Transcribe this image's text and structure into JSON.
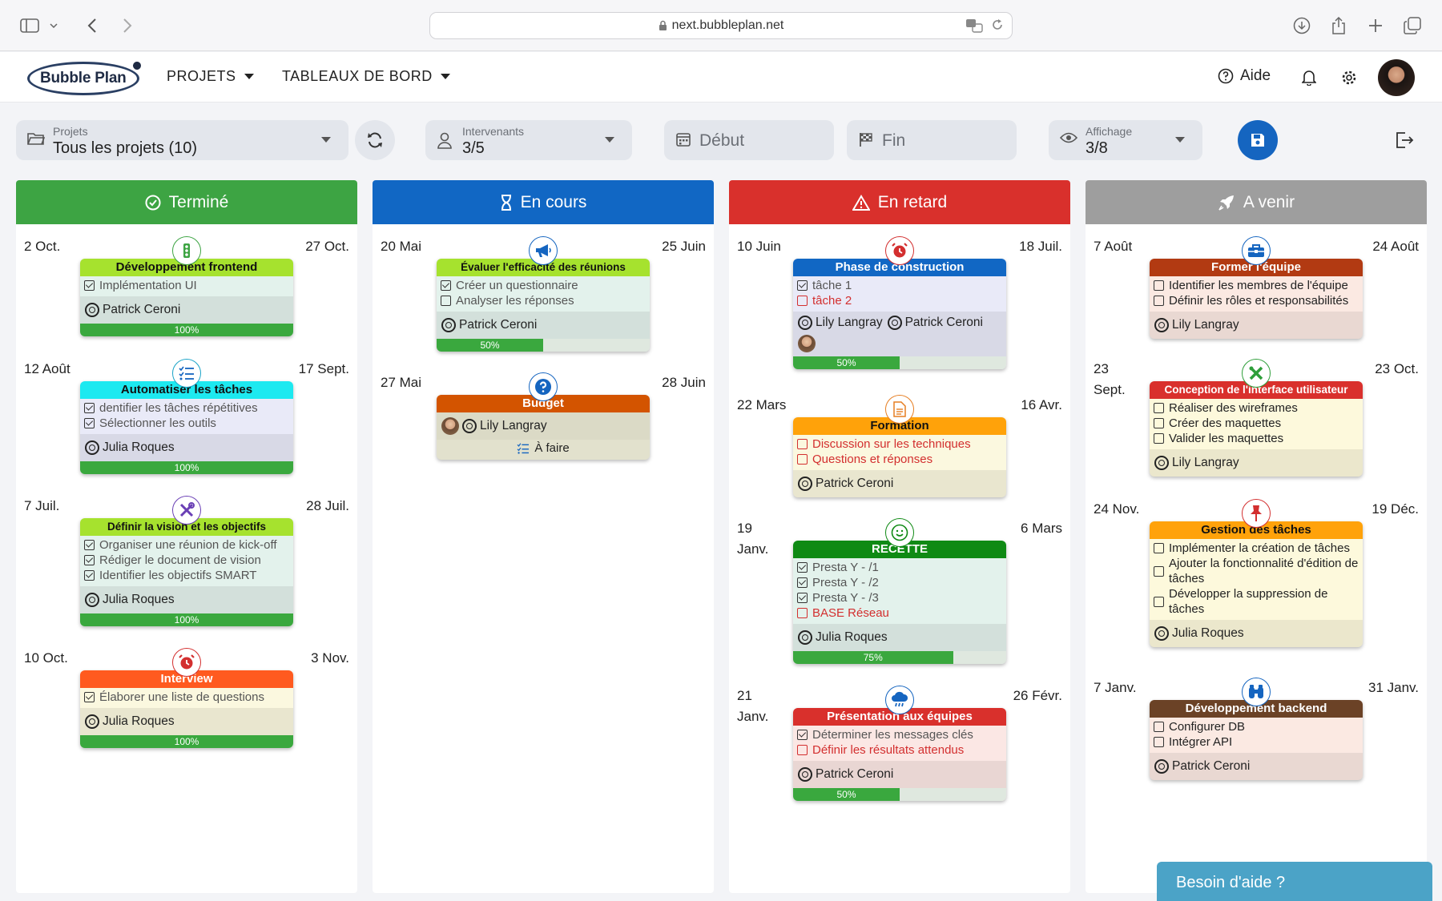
{
  "browser": {
    "url": "next.bubbleplan.net"
  },
  "header": {
    "logo": "Bubble Plan",
    "menus": [
      {
        "label": "PROJETS"
      },
      {
        "label": "TABLEAUX DE BORD"
      }
    ],
    "help_label": "Aide"
  },
  "filters": {
    "projects": {
      "label": "Projets",
      "value": "Tous les projets (10)"
    },
    "people": {
      "label": "Intervenants",
      "value": "3/5"
    },
    "start": {
      "placeholder": "Début"
    },
    "end": {
      "placeholder": "Fin"
    },
    "display": {
      "label": "Affichage",
      "value": "3/8"
    }
  },
  "columns": [
    {
      "title": "Terminé",
      "color": "#3da443",
      "icon": "check-circle-icon",
      "tasks": [
        {
          "start": "2 Oct.",
          "end": "27 Oct.",
          "title": "Développement frontend",
          "title_bg": "#a6e22e",
          "body_bg": "#e3f2ec",
          "icon": "traffic-light-icon",
          "icon_color": "#3da443",
          "items": [
            {
              "text": "Implémentation UI",
              "checked": true,
              "late": false
            }
          ],
          "people": [
            {
              "name": "Patrick Ceroni",
              "photo": false
            }
          ],
          "progress": 1.0,
          "progress_label": "100%"
        },
        {
          "start": "12 Août",
          "end": "17 Sept.",
          "title": "Automatiser les tâches",
          "title_bg": "#1de9f0",
          "body_bg": "#e9eaf8",
          "icon": "list-check-icon",
          "icon_color": "#1aa3c7",
          "items": [
            {
              "text": "dentifier les tâches répétitives",
              "checked": true,
              "late": false
            },
            {
              "text": "Sélectionner les outils",
              "checked": true,
              "late": false
            }
          ],
          "people": [
            {
              "name": "Julia Roques",
              "photo": false
            }
          ],
          "progress": 1.0,
          "progress_label": "100%"
        },
        {
          "start": "7 Juil.",
          "end": "28 Juil.",
          "title": "Définir la vision et les objectifs",
          "title_bg": "#a6e22e",
          "body_bg": "#e3f2ec",
          "icon": "tools-icon",
          "icon_color": "#6a3fb5",
          "items": [
            {
              "text": "Organiser une réunion de kick-off",
              "checked": true,
              "late": false
            },
            {
              "text": "Rédiger le document de vision",
              "checked": true,
              "late": false
            },
            {
              "text": "Identifier les objectifs SMART",
              "checked": true,
              "late": false
            }
          ],
          "people": [
            {
              "name": "Julia Roques",
              "photo": false
            }
          ],
          "progress": 1.0,
          "progress_label": "100%"
        },
        {
          "start": "10 Oct.",
          "end": "3 Nov.",
          "title": "Interview",
          "title_bg": "#ff5a1f",
          "title_color": "#fff",
          "body_bg": "#fbf8df",
          "icon": "alarm-icon",
          "icon_color": "#d32f2f",
          "items": [
            {
              "text": "Élaborer une liste de questions",
              "checked": true,
              "late": false
            }
          ],
          "people": [
            {
              "name": "Julia Roques",
              "photo": false
            }
          ],
          "progress": 1.0,
          "progress_label": "100%"
        }
      ]
    },
    {
      "title": "En cours",
      "color": "#1167c4",
      "icon": "hourglass-icon",
      "tasks": [
        {
          "start": "20 Mai",
          "end": "25 Juin",
          "title": "Évaluer l'efficacité des réunions",
          "title_bg": "#a6e22e",
          "body_bg": "#e3f2ec",
          "icon": "megaphone-icon",
          "icon_color": "#1565c0",
          "items": [
            {
              "text": "Créer un questionnaire",
              "checked": true,
              "late": false
            },
            {
              "text": "Analyser les réponses",
              "checked": false,
              "late": false
            }
          ],
          "people": [
            {
              "name": "Patrick Ceroni",
              "photo": false
            }
          ],
          "progress": 0.5,
          "progress_label": "50%"
        },
        {
          "start": "27 Mai",
          "end": "28 Juin",
          "title": "Budget",
          "title_bg": "#d35400",
          "title_color": "#fff",
          "body_bg": "#ecebd6",
          "icon": "question-icon",
          "icon_color": "#1565c0",
          "items": [],
          "people": [
            {
              "name": "Lily Langray",
              "photo": true
            }
          ],
          "status": "À faire"
        }
      ]
    },
    {
      "title": "En retard",
      "color": "#d9302c",
      "icon": "warning-icon",
      "tasks": [
        {
          "start": "10 Juin",
          "end": "18 Juil.",
          "title": "Phase de construction",
          "title_bg": "#1167c4",
          "title_color": "#fff",
          "body_bg": "#e9eaf8",
          "icon": "alarm-icon",
          "icon_color": "#d32f2f",
          "items": [
            {
              "text": "tâche 1",
              "checked": true,
              "late": false
            },
            {
              "text": "tâche 2",
              "checked": false,
              "late": true
            }
          ],
          "people": [
            {
              "name": "Lily Langray",
              "photo": false
            },
            {
              "name": "Patrick Ceroni",
              "photo": false
            },
            {
              "name": "",
              "photo": true
            }
          ],
          "progress": 0.5,
          "progress_label": "50%"
        },
        {
          "start": "22 Mars",
          "end": "16 Avr.",
          "title": "Formation",
          "title_bg": "#ffa20a",
          "body_bg": "#fbf8df",
          "icon": "document-icon",
          "icon_color": "#e67e22",
          "items": [
            {
              "text": "Discussion sur les techniques",
              "checked": false,
              "late": true
            },
            {
              "text": "Questions et réponses",
              "checked": false,
              "late": true
            }
          ],
          "people": [
            {
              "name": "Patrick Ceroni",
              "photo": false
            }
          ]
        },
        {
          "start": "19 Janv.",
          "end": "6 Mars",
          "title": "RECETTE",
          "title_bg": "#0f8a14",
          "title_color": "#fff",
          "body_bg": "#e3f2ec",
          "icon": "smile-icon",
          "icon_color": "#0f8a14",
          "items": [
            {
              "text": "Presta Y - /1",
              "checked": true,
              "late": false
            },
            {
              "text": "Presta Y - /2",
              "checked": true,
              "late": false
            },
            {
              "text": "Presta Y - /3",
              "checked": true,
              "late": false
            },
            {
              "text": "BASE Réseau",
              "checked": false,
              "late": true
            }
          ],
          "people": [
            {
              "name": "Julia Roques",
              "photo": false
            }
          ],
          "progress": 0.75,
          "progress_label": "75%"
        },
        {
          "start": "21 Janv.",
          "end": "26 Févr.",
          "title": "Présentation aux équipes",
          "title_bg": "#d9302c",
          "title_color": "#fff",
          "body_bg": "#fbe7e4",
          "icon": "rain-cloud-icon",
          "icon_color": "#1565c0",
          "items": [
            {
              "text": "Déterminer les messages clés",
              "checked": true,
              "late": false
            },
            {
              "text": "Définir les résultats attendus",
              "checked": false,
              "late": true
            }
          ],
          "people": [
            {
              "name": "Patrick Ceroni",
              "photo": false
            }
          ],
          "progress": 0.5,
          "progress_label": "50%"
        }
      ]
    },
    {
      "title": "A venir",
      "color": "#9e9e9e",
      "icon": "rocket-icon",
      "tasks": [
        {
          "start": "7 Août",
          "end": "24 Août",
          "title": "Former l'équipe",
          "title_bg": "#b23a12",
          "title_color": "#fff",
          "body_bg": "#fbe9e2",
          "icon": "toolbox-icon",
          "icon_color": "#1565c0",
          "items": [
            {
              "text": "Identifier les membres de l'équipe",
              "checked": false,
              "late": false,
              "dark": true
            },
            {
              "text": "Définir les rôles et responsabilités",
              "checked": false,
              "late": false,
              "dark": true
            }
          ],
          "people": [
            {
              "name": "Lily Langray",
              "photo": false
            }
          ]
        },
        {
          "start": "23 Sept.",
          "end": "23 Oct.",
          "title": "Conception de l'interface utilisateur",
          "title_bg": "#d9302c",
          "title_color": "#fff",
          "body_bg": "#fdf9dc",
          "icon": "design-tools-icon",
          "icon_color": "#2e9e3a",
          "items": [
            {
              "text": "Réaliser des wireframes",
              "checked": false,
              "late": false,
              "dark": true
            },
            {
              "text": "Créer des maquettes",
              "checked": false,
              "late": false,
              "dark": true
            },
            {
              "text": "Valider les maquettes",
              "checked": false,
              "late": false,
              "dark": true
            }
          ],
          "people": [
            {
              "name": "Lily Langray",
              "photo": false
            }
          ]
        },
        {
          "start": "24 Nov.",
          "end": "19 Déc.",
          "title": "Gestion des tâches",
          "title_bg": "#ffa20a",
          "body_bg": "#fdf9dc",
          "icon": "pin-icon",
          "icon_color": "#d32f2f",
          "items": [
            {
              "text": "Implémenter la création de tâches",
              "checked": false,
              "late": false,
              "dark": true
            },
            {
              "text": "Ajouter la fonctionnalité d'édition de tâches",
              "checked": false,
              "late": false,
              "dark": true
            },
            {
              "text": "Développer la suppression de tâches",
              "checked": false,
              "late": false,
              "dark": true
            }
          ],
          "people": [
            {
              "name": "Julia Roques",
              "photo": false
            }
          ]
        },
        {
          "start": "7 Janv.",
          "end": "31 Janv.",
          "title": "Développement backend",
          "title_bg": "#6b4226",
          "title_color": "#fff",
          "body_bg": "#fbe9e2",
          "icon": "binoculars-icon",
          "icon_color": "#1565c0",
          "items": [
            {
              "text": "Configurer DB",
              "checked": false,
              "late": false,
              "dark": true
            },
            {
              "text": "Intégrer API",
              "checked": false,
              "late": false,
              "dark": true
            }
          ],
          "people": [
            {
              "name": "Patrick Ceroni",
              "photo": false
            }
          ]
        }
      ]
    }
  ],
  "help_button": "Besoin d'aide ?"
}
